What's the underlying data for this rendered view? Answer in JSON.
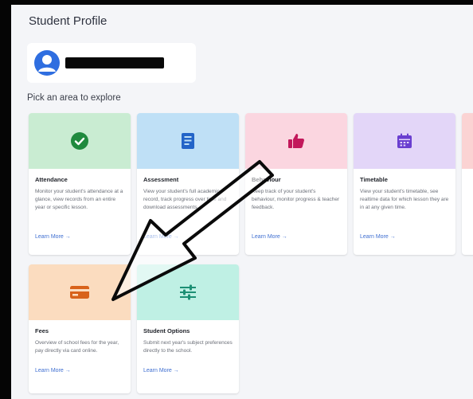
{
  "page": {
    "title": "Student Profile"
  },
  "student": {
    "name": ""
  },
  "explore": {
    "label": "Pick an area to explore"
  },
  "colors": {
    "attendance": "#c9ecd2",
    "assessment": "#bfe0f6",
    "behaviour": "#fbd6e0",
    "timetable": "#e3d6f8",
    "fifth": "#fbd3d3",
    "fees": "#fbdcbf",
    "options": "#bff0e4",
    "link": "#3f6fd1"
  },
  "cards": [
    {
      "key": "attendance",
      "icon": "check-circle-icon",
      "title": "Attendance",
      "description": "Monitor your student's attendance at a glance, view records from an entire year or specific lesson.",
      "link": "Learn More →"
    },
    {
      "key": "assessment",
      "icon": "clipboard-icon",
      "title": "Assessment",
      "description": "View your student's full academic record, track progress over time and download assessments.",
      "link": "Learn More →"
    },
    {
      "key": "behaviour",
      "icon": "thumbs-up-icon",
      "title": "Behaviour",
      "description": "Keep track of your student's behaviour, monitor progress & teacher feedback.",
      "link": "Learn More →"
    },
    {
      "key": "timetable",
      "icon": "calendar-icon",
      "title": "Timetable",
      "description": "View your student's timetable, see realtime data for which lesson they are in at any given time.",
      "link": "Learn More →"
    },
    {
      "key": "fees",
      "icon": "credit-card-icon",
      "title": "Fees",
      "description": "Overview of school fees for the year, pay directly via card online.",
      "link": "Learn More →"
    },
    {
      "key": "options",
      "icon": "sliders-icon",
      "title": "Student Options",
      "description": "Submit next year's subject preferences directly to the school.",
      "link": "Learn More →"
    }
  ]
}
